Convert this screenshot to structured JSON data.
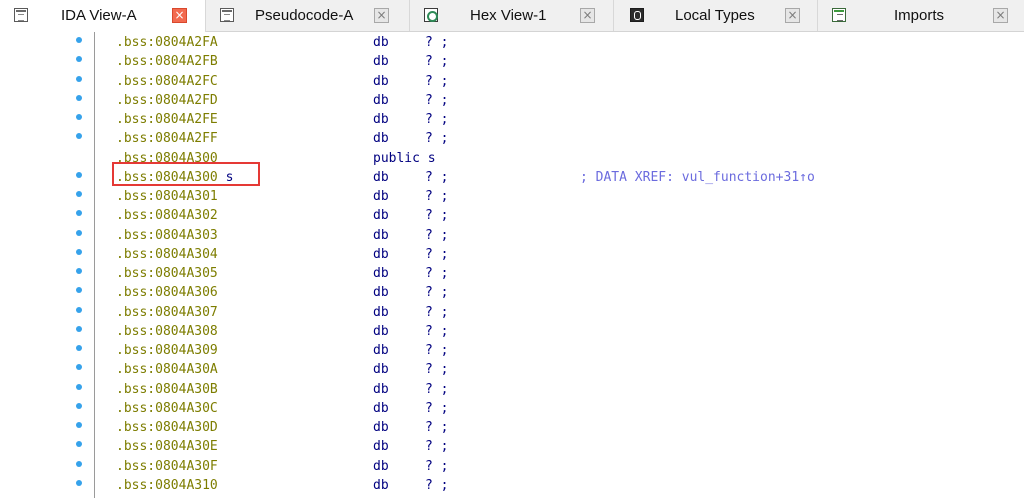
{
  "tabs": [
    {
      "label": "IDA View-A",
      "icon": "ida-view-icon",
      "active": true
    },
    {
      "label": "Pseudocode-A",
      "icon": "pseudocode-icon",
      "active": false
    },
    {
      "label": "Hex View-1",
      "icon": "hex-view-icon",
      "active": false
    },
    {
      "label": "Local Types",
      "icon": "local-types-icon",
      "active": false
    },
    {
      "label": "Imports",
      "icon": "imports-icon",
      "active": false
    }
  ],
  "close_glyph": "×",
  "colors": {
    "address": "#7d7d00",
    "instruction": "#000080",
    "comment": "#6b6bde",
    "highlight_box": "#e53935",
    "active_close": "#f26a4f",
    "gutter_dot": "#36a2eb"
  },
  "lines": [
    {
      "addr": ".bss:0804A2FA",
      "name": "",
      "mnem": "db",
      "oper": "? ;",
      "comment": "",
      "dot": true
    },
    {
      "addr": ".bss:0804A2FB",
      "name": "",
      "mnem": "db",
      "oper": "? ;",
      "comment": "",
      "dot": true
    },
    {
      "addr": ".bss:0804A2FC",
      "name": "",
      "mnem": "db",
      "oper": "? ;",
      "comment": "",
      "dot": true
    },
    {
      "addr": ".bss:0804A2FD",
      "name": "",
      "mnem": "db",
      "oper": "? ;",
      "comment": "",
      "dot": true
    },
    {
      "addr": ".bss:0804A2FE",
      "name": "",
      "mnem": "db",
      "oper": "? ;",
      "comment": "",
      "dot": true
    },
    {
      "addr": ".bss:0804A2FF",
      "name": "",
      "mnem": "db",
      "oper": "? ;",
      "comment": "",
      "dot": true
    },
    {
      "addr": ".bss:0804A300",
      "name": "",
      "mnem": "public s",
      "oper": "",
      "comment": "",
      "dot": false
    },
    {
      "addr": ".bss:0804A300",
      "name": "s",
      "mnem": "db",
      "oper": "? ;",
      "comment": "; DATA XREF: vul_function+31↑o",
      "dot": true
    },
    {
      "addr": ".bss:0804A301",
      "name": "",
      "mnem": "db",
      "oper": "? ;",
      "comment": "",
      "dot": true
    },
    {
      "addr": ".bss:0804A302",
      "name": "",
      "mnem": "db",
      "oper": "? ;",
      "comment": "",
      "dot": true
    },
    {
      "addr": ".bss:0804A303",
      "name": "",
      "mnem": "db",
      "oper": "? ;",
      "comment": "",
      "dot": true
    },
    {
      "addr": ".bss:0804A304",
      "name": "",
      "mnem": "db",
      "oper": "? ;",
      "comment": "",
      "dot": true
    },
    {
      "addr": ".bss:0804A305",
      "name": "",
      "mnem": "db",
      "oper": "? ;",
      "comment": "",
      "dot": true
    },
    {
      "addr": ".bss:0804A306",
      "name": "",
      "mnem": "db",
      "oper": "? ;",
      "comment": "",
      "dot": true
    },
    {
      "addr": ".bss:0804A307",
      "name": "",
      "mnem": "db",
      "oper": "? ;",
      "comment": "",
      "dot": true
    },
    {
      "addr": ".bss:0804A308",
      "name": "",
      "mnem": "db",
      "oper": "? ;",
      "comment": "",
      "dot": true
    },
    {
      "addr": ".bss:0804A309",
      "name": "",
      "mnem": "db",
      "oper": "? ;",
      "comment": "",
      "dot": true
    },
    {
      "addr": ".bss:0804A30A",
      "name": "",
      "mnem": "db",
      "oper": "? ;",
      "comment": "",
      "dot": true
    },
    {
      "addr": ".bss:0804A30B",
      "name": "",
      "mnem": "db",
      "oper": "? ;",
      "comment": "",
      "dot": true
    },
    {
      "addr": ".bss:0804A30C",
      "name": "",
      "mnem": "db",
      "oper": "? ;",
      "comment": "",
      "dot": true
    },
    {
      "addr": ".bss:0804A30D",
      "name": "",
      "mnem": "db",
      "oper": "? ;",
      "comment": "",
      "dot": true
    },
    {
      "addr": ".bss:0804A30E",
      "name": "",
      "mnem": "db",
      "oper": "? ;",
      "comment": "",
      "dot": true
    },
    {
      "addr": ".bss:0804A30F",
      "name": "",
      "mnem": "db",
      "oper": "? ;",
      "comment": "",
      "dot": true
    },
    {
      "addr": ".bss:0804A310",
      "name": "",
      "mnem": "db",
      "oper": "? ;",
      "comment": "",
      "dot": true
    }
  ]
}
